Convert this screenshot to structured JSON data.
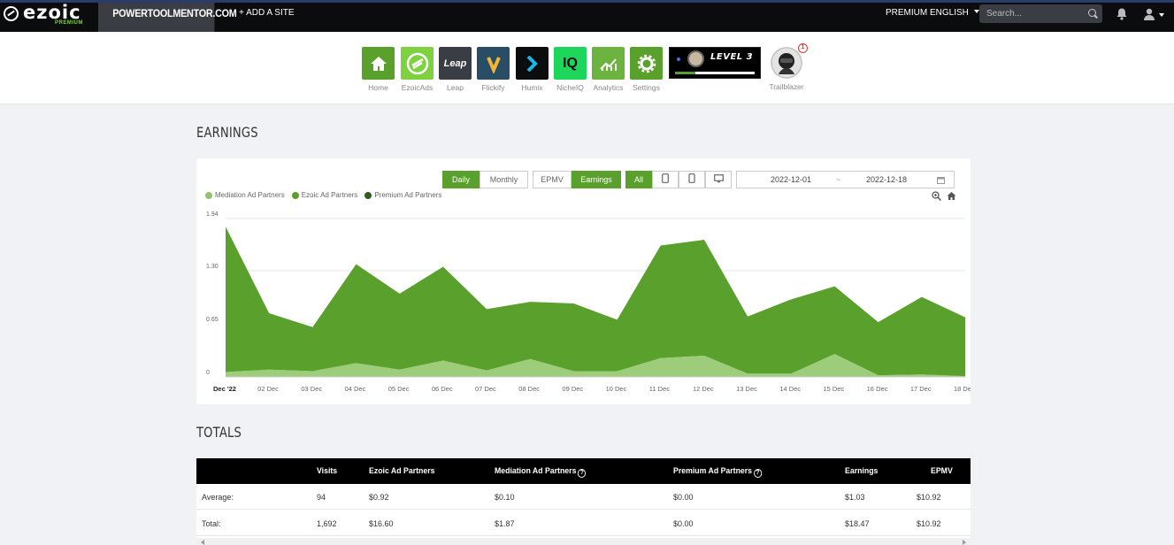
{
  "topbar": {
    "logo": "ezoic",
    "logo_sub": "PREMIUM",
    "site": "POWERTOOLMENTOR.COM",
    "add_site": "+ ADD A SITE",
    "premium": "PREMIUM",
    "language": "ENGLISH",
    "search_placeholder": "Search..."
  },
  "apps": [
    {
      "label": "Home",
      "icon": "home-icon",
      "color": "#5aa02c"
    },
    {
      "label": "EzoicAds",
      "icon": "ezoicads-icon",
      "color": "#7ed23f"
    },
    {
      "label": "Leap",
      "icon": "leap-icon",
      "color": "#3a3d43",
      "tile_text": "Leap"
    },
    {
      "label": "Flickify",
      "icon": "flickify-icon",
      "color": "#2a4d66"
    },
    {
      "label": "Humix",
      "icon": "humix-icon",
      "color": "#0b0c0e"
    },
    {
      "label": "NicheIQ",
      "icon": "nicheiq-icon",
      "color": "#1fd65c",
      "tile_text": "IQ"
    },
    {
      "label": "Analytics",
      "icon": "analytics-icon",
      "color": "#6cb33f"
    },
    {
      "label": "Settings",
      "icon": "gear-icon",
      "color": "#5aa02c"
    }
  ],
  "level": {
    "text": "LEVEL 3",
    "progress": 0.25
  },
  "trailblazer": {
    "label": "Trailblazer",
    "badge": "1"
  },
  "earnings": {
    "title": "EARNINGS",
    "buttons": {
      "daily": "Daily",
      "monthly": "Monthly",
      "epmv": "EPMV",
      "earnings": "Earnings",
      "all": "All"
    },
    "date_from": "2022-12-01",
    "date_sep": "~",
    "date_to": "2022-12-18"
  },
  "chart_data": {
    "type": "area",
    "categories": [
      "Dec '22",
      "02 Dec",
      "03 Dec",
      "04 Dec",
      "05 Dec",
      "06 Dec",
      "07 Dec",
      "08 Dec",
      "09 Dec",
      "10 Dec",
      "11 Dec",
      "12 Dec",
      "13 Dec",
      "14 Dec",
      "15 Dec",
      "16 Dec",
      "17 Dec",
      "18 Dec"
    ],
    "yticks": [
      "0",
      "0.65",
      "1.30",
      "1.94"
    ],
    "ylim": [
      0,
      1.94
    ],
    "legend_placement": "top-left",
    "series": [
      {
        "name": "Mediation Ad Partners",
        "color": "#8fc46a",
        "values": [
          0.06,
          0.09,
          0.07,
          0.17,
          0.09,
          0.2,
          0.08,
          0.22,
          0.07,
          0.07,
          0.23,
          0.26,
          0.04,
          0.04,
          0.28,
          0.02,
          0.03,
          0.01
        ]
      },
      {
        "name": "Ezoic Ad Partners",
        "color": "#5aa02c",
        "values": [
          1.78,
          0.69,
          0.54,
          1.21,
          0.93,
          1.15,
          0.75,
          0.7,
          0.83,
          0.63,
          1.38,
          1.42,
          0.7,
          0.91,
          0.83,
          0.65,
          0.95,
          0.72
        ]
      },
      {
        "name": "Premium Ad Partners",
        "color": "#2f5e18",
        "values": [
          0,
          0,
          0,
          0,
          0,
          0,
          0,
          0,
          0,
          0,
          0,
          0,
          0,
          0,
          0,
          0,
          0,
          0
        ]
      }
    ]
  },
  "totals": {
    "title": "TOTALS",
    "headers": [
      "",
      "Visits",
      "Ezoic Ad Partners",
      "Mediation Ad Partners",
      "Premium Ad Partners",
      "Earnings",
      "EPMV"
    ],
    "rows": [
      [
        "Average:",
        "94",
        "$0.92",
        "$0.10",
        "$0.00",
        "$1.03",
        "$10.92"
      ],
      [
        "Total:",
        "1,692",
        "$16.60",
        "$1.87",
        "$0.00",
        "$18.47",
        "$10.92"
      ]
    ]
  }
}
